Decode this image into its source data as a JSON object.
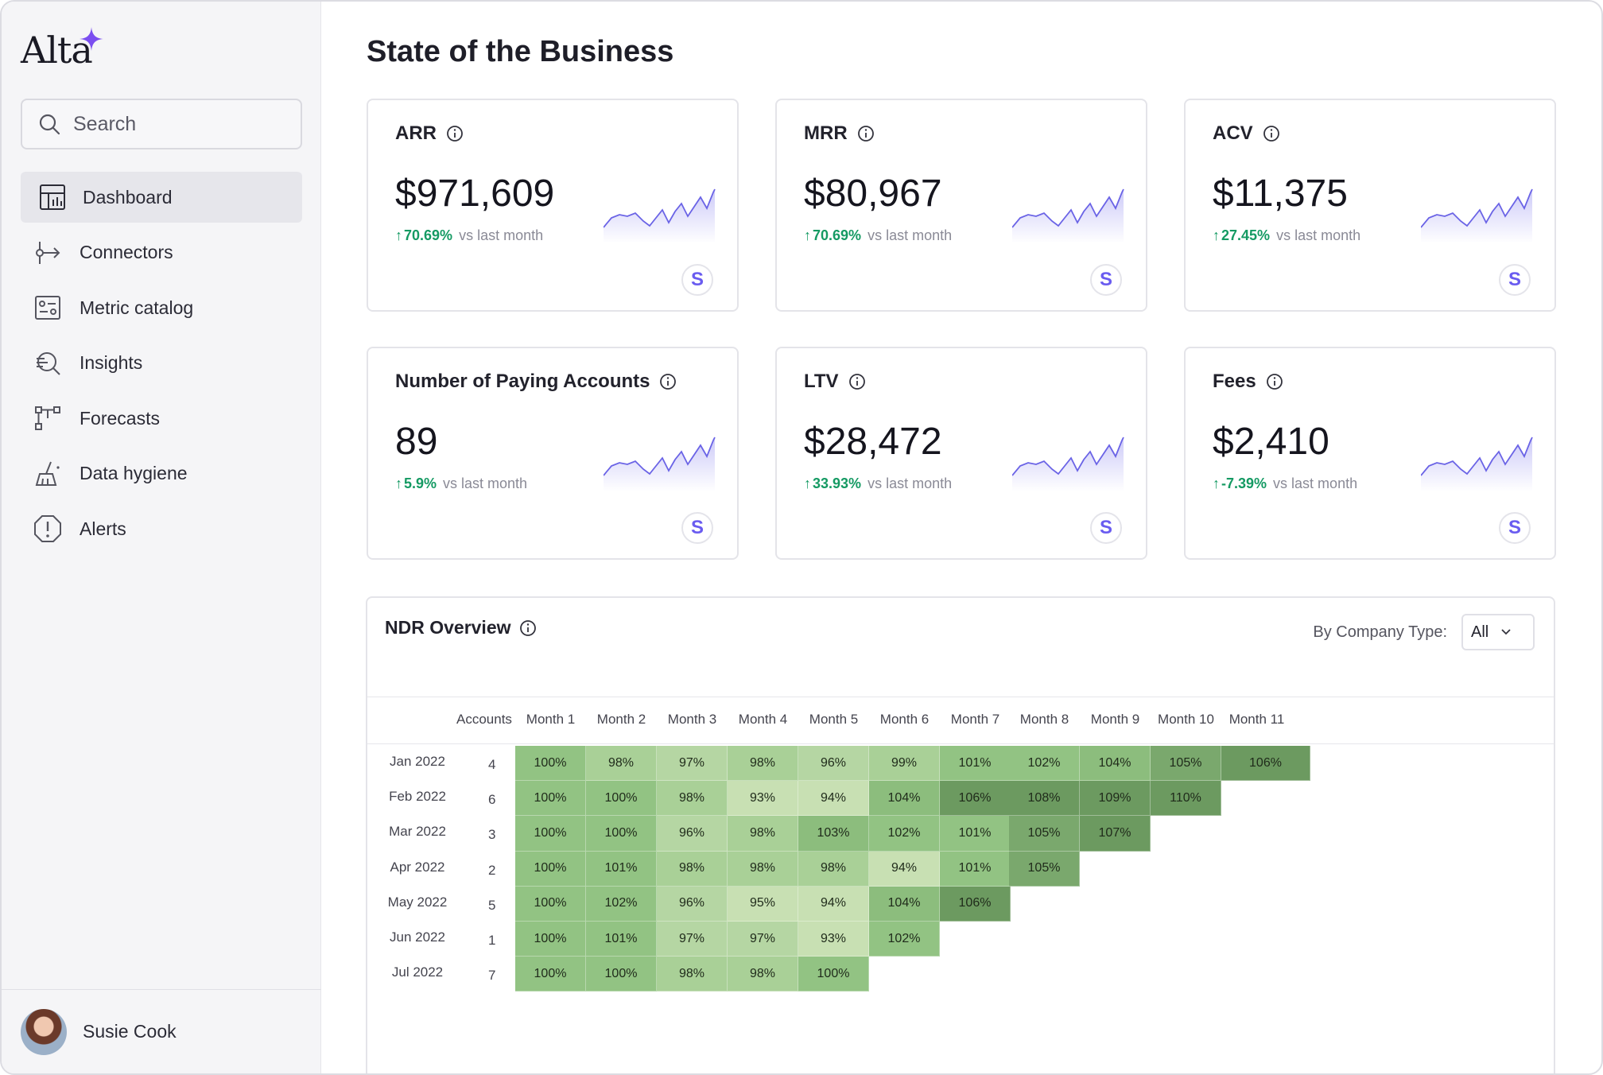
{
  "brand": {
    "name": "Alta",
    "star_color": "#7b4ef0"
  },
  "search": {
    "placeholder": "Search"
  },
  "nav": [
    {
      "label": "Dashboard",
      "icon": "dashboard-icon",
      "active": true
    },
    {
      "label": "Connectors",
      "icon": "connectors-icon"
    },
    {
      "label": "Metric catalog",
      "icon": "metric-catalog-icon"
    },
    {
      "label": "Insights",
      "icon": "insights-icon"
    },
    {
      "label": "Forecasts",
      "icon": "forecasts-icon"
    },
    {
      "label": "Data hygiene",
      "icon": "data-hygiene-icon"
    },
    {
      "label": "Alerts",
      "icon": "alerts-icon"
    }
  ],
  "user": {
    "name": "Susie Cook"
  },
  "page": {
    "title": "State of the Business"
  },
  "metrics": [
    {
      "label": "ARR",
      "value": "$971,609",
      "delta": "70.69%",
      "vs": "vs last month"
    },
    {
      "label": "MRR",
      "value": "$80,967",
      "delta": "70.69%",
      "vs": "vs last month"
    },
    {
      "label": "ACV",
      "value": "$11,375",
      "delta": "27.45%",
      "vs": "vs last month"
    },
    {
      "label": "Number of Paying Accounts",
      "value": "89",
      "delta": "5.9%",
      "vs": "vs last month"
    },
    {
      "label": "LTV",
      "value": "$28,472",
      "delta": "33.93%",
      "vs": "vs last month"
    },
    {
      "label": "Fees",
      "value": "$2,410",
      "delta": "-7.39%",
      "vs": "vs last month"
    }
  ],
  "source_badge": "S",
  "colors": {
    "positive": "#159a63",
    "spark_line": "#6a63e6",
    "badge": "#6a5cf0"
  },
  "ndr": {
    "title": "NDR Overview",
    "filter_label": "By Company Type:",
    "filter_value": "All",
    "headers": [
      "Accounts",
      "Month 1",
      "Month 2",
      "Month 3",
      "Month 4",
      "Month 5",
      "Month 6",
      "Month 7",
      "Month 8",
      "Month 9",
      "Month 10",
      "Month 11"
    ],
    "rows": [
      {
        "cohort": "Jan 2022",
        "accounts": "4",
        "values": [
          "100%",
          "98%",
          "97%",
          "98%",
          "96%",
          "99%",
          "101%",
          "102%",
          "104%",
          "105%",
          "106%"
        ]
      },
      {
        "cohort": "Feb 2022",
        "accounts": "6",
        "values": [
          "100%",
          "100%",
          "98%",
          "93%",
          "94%",
          "104%",
          "106%",
          "108%",
          "109%",
          "110%"
        ]
      },
      {
        "cohort": "Mar 2022",
        "accounts": "3",
        "values": [
          "100%",
          "100%",
          "96%",
          "98%",
          "103%",
          "102%",
          "101%",
          "105%",
          "107%"
        ]
      },
      {
        "cohort": "Apr 2022",
        "accounts": "2",
        "values": [
          "100%",
          "101%",
          "98%",
          "98%",
          "98%",
          "94%",
          "101%",
          "105%"
        ]
      },
      {
        "cohort": "May 2022",
        "accounts": "5",
        "values": [
          "100%",
          "102%",
          "96%",
          "95%",
          "94%",
          "104%",
          "106%"
        ]
      },
      {
        "cohort": "Jun 2022",
        "accounts": "1",
        "values": [
          "100%",
          "101%",
          "97%",
          "97%",
          "93%",
          "102%"
        ]
      },
      {
        "cohort": "Jul 2022",
        "accounts": "7",
        "values": [
          "100%",
          "100%",
          "98%",
          "98%",
          "100%"
        ]
      }
    ]
  }
}
